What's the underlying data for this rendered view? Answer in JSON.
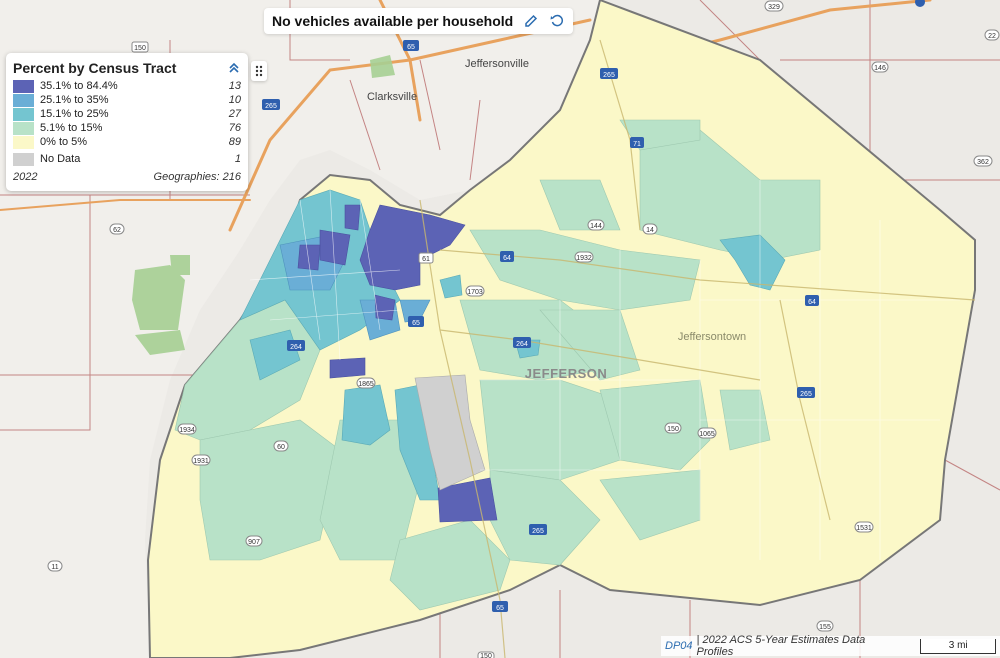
{
  "title": {
    "text": "No vehicles available per household",
    "edit_icon": "pencil-icon",
    "reset_icon": "reset-icon"
  },
  "legend": {
    "title": "Percent by Census Tract",
    "collapse_icon": "chevron-up-double-icon",
    "rows": [
      {
        "label": "35.1% to 84.4%",
        "count": "13",
        "color": "#5c63b5"
      },
      {
        "label": "25.1% to 35%",
        "count": "10",
        "color": "#6aaed6"
      },
      {
        "label": "15.1% to 25%",
        "count": "27",
        "color": "#74c5d0"
      },
      {
        "label": "5.1% to 15%",
        "count": "76",
        "color": "#b8e2c8"
      },
      {
        "label": "0% to 5%",
        "count": "89",
        "color": "#fbf8c8"
      }
    ],
    "nodata": {
      "label": "No Data",
      "count": "1",
      "color": "#d0d0d0"
    },
    "year": "2022",
    "geographies": "Geographies: 216"
  },
  "drag_handle_icon": "drag-handle-icon",
  "map": {
    "county_label": "JEFFERSON",
    "place_labels": [
      "Jeffersonville",
      "Clarksville",
      "Jeffersontown"
    ],
    "road_shields": [
      "150",
      "65",
      "265",
      "62",
      "11",
      "64",
      "71",
      "264",
      "146",
      "329",
      "362",
      "1932",
      "1703",
      "1865",
      "1934",
      "907",
      "1065",
      "1531",
      "144",
      "14",
      "22",
      "150",
      "61",
      "155",
      "1931"
    ]
  },
  "source": {
    "link": "DP04",
    "text": "| 2022 ACS 5-Year Estimates Data Profiles",
    "scale": "3 mi"
  }
}
